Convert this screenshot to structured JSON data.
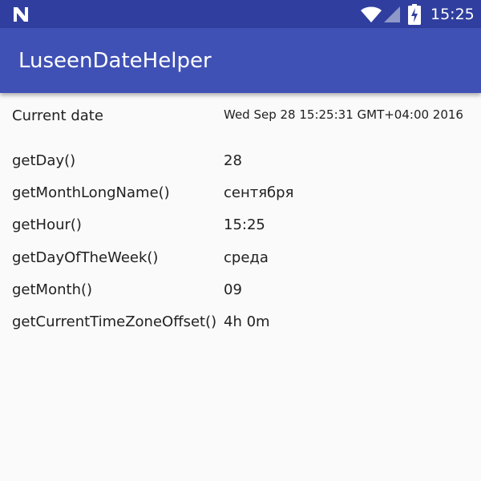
{
  "status_bar": {
    "time": "15:25",
    "icons": [
      "notification-n-icon",
      "wifi-icon",
      "cell-signal-icon",
      "battery-charging-icon"
    ],
    "color": "#303f9f"
  },
  "app_bar": {
    "title": "LuseenDateHelper",
    "color": "#3f51b5"
  },
  "rows": [
    {
      "label": "Current date",
      "value": "Wed Sep 28 15:25:31 GMT+04:00 2016"
    },
    {
      "label": "getDay()",
      "value": "28"
    },
    {
      "label": "getMonthLongName()",
      "value": "сентября"
    },
    {
      "label": "getHour()",
      "value": "15:25"
    },
    {
      "label": "getDayOfTheWeek()",
      "value": "среда"
    },
    {
      "label": "getMonth()",
      "value": "09"
    },
    {
      "label": "getCurrentTimeZoneOffset()",
      "value": "4h 0m"
    }
  ]
}
